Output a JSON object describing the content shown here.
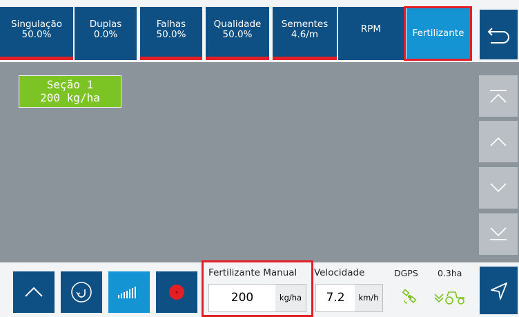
{
  "tabs": [
    {
      "label": "Singulação",
      "value": "50.0%"
    },
    {
      "label": "Duplas",
      "value": "0.0%"
    },
    {
      "label": "Falhas",
      "value": "50.0%"
    },
    {
      "label": "Qualidade",
      "value": "50.0%"
    },
    {
      "label": "Sementes",
      "value": "4.6/m"
    },
    {
      "label": "RPM",
      "value": ""
    },
    {
      "label": "Fertilizante",
      "value": ""
    }
  ],
  "section": {
    "name": "Seção 1",
    "rate": "200 kg/ha"
  },
  "bottom": {
    "fertilizer_label": "Fertilizante Manual",
    "fertilizer_value": "200",
    "fertilizer_unit": "kg/ha",
    "speed_label": "Velocidade",
    "speed_value": "7.2",
    "speed_unit": "km/h",
    "gps_label": "DGPS",
    "area_value": "0.3ha"
  },
  "icons": {
    "back": "back-arrow-icon",
    "scroll_top": "double-up-icon",
    "scroll_up": "chevron-up-icon",
    "scroll_down": "chevron-down-icon",
    "scroll_bottom": "double-down-icon",
    "expand": "chevron-up-icon",
    "refresh": "rotate-icon",
    "rate": "bars-icon",
    "record": "record-icon",
    "satellite": "satellite-icon",
    "tractor": "tractor-icon",
    "send": "navigation-arrow-icon"
  },
  "colors": {
    "tab_bg": "#0e4f84",
    "tab_active": "#1494d2",
    "alert_red": "#e31e24",
    "section_green": "#7cc423",
    "gps_green": "#7cc423"
  }
}
